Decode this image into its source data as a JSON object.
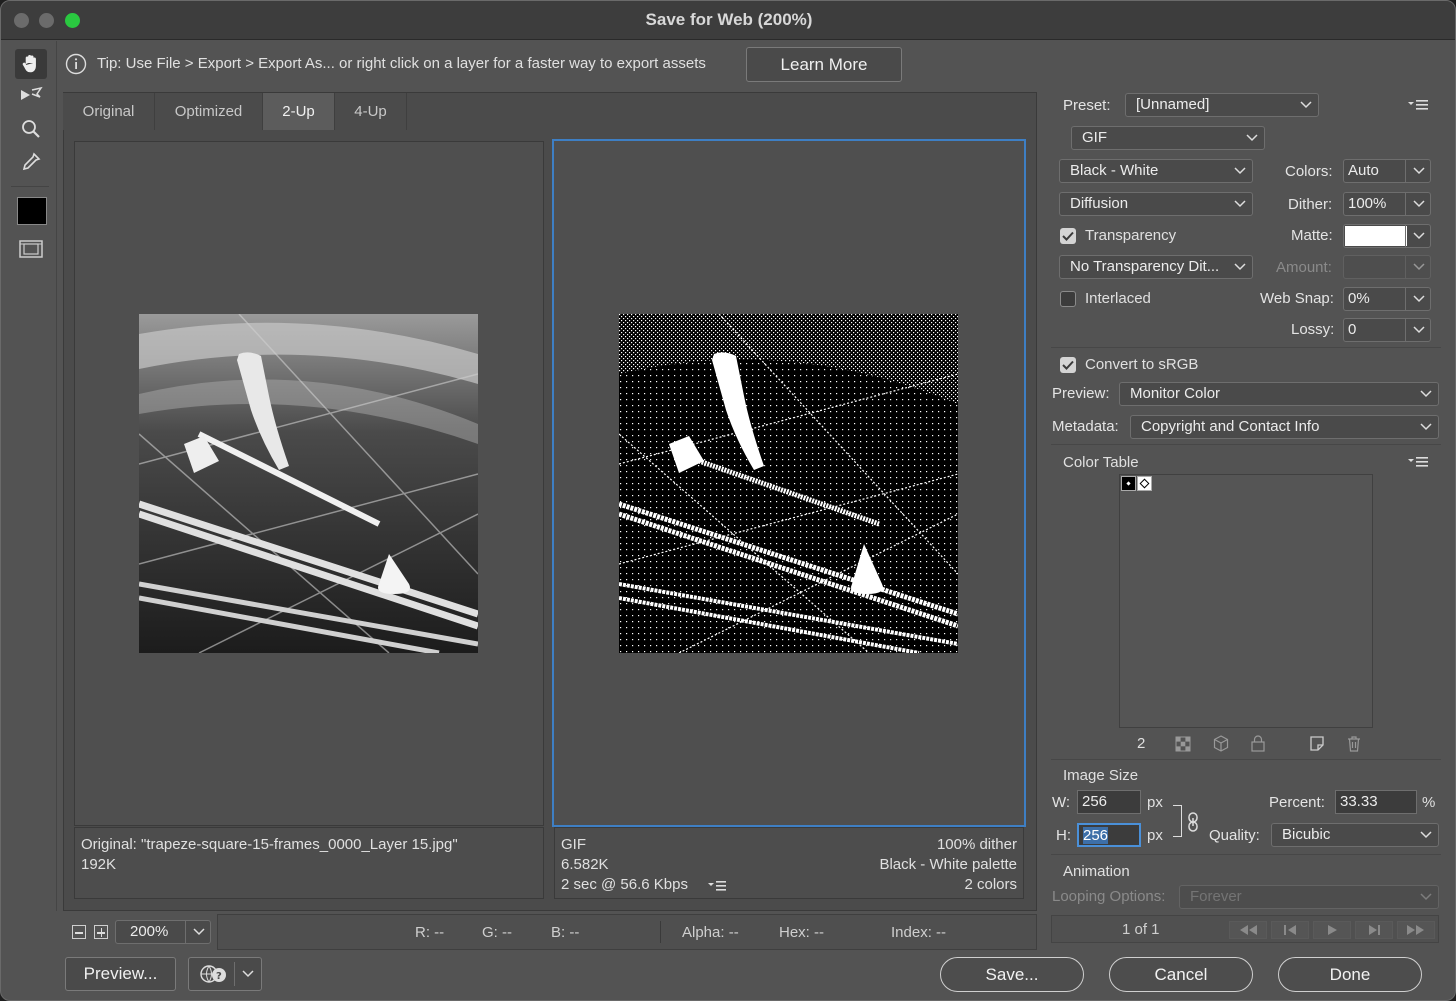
{
  "window": {
    "title": "Save for Web (200%)"
  },
  "tip": {
    "text": "Tip: Use File > Export > Export As...  or right click on a layer for a faster way to export assets",
    "learn_more": "Learn More"
  },
  "tabs": [
    {
      "label": "Original"
    },
    {
      "label": "Optimized"
    },
    {
      "label": "2-Up",
      "active": true
    },
    {
      "label": "4-Up"
    }
  ],
  "left_pane": {
    "name": "Original: \"trapeze-square-15-frames_0000_Layer 15.jpg\"",
    "size": "192K"
  },
  "right_pane": {
    "format": "GIF",
    "size": "6.582K",
    "time": "2 sec @ 56.6 Kbps",
    "dither": "100% dither",
    "palette": "Black - White palette",
    "colors": "2 colors"
  },
  "settings": {
    "preset_label": "Preset:",
    "preset_value": "[Unnamed]",
    "format_value": "GIF",
    "reduction_value": "Black - White",
    "colors_label": "Colors:",
    "colors_value": "Auto",
    "dither_algo": "Diffusion",
    "dither_label": "Dither:",
    "dither_value": "100%",
    "transparency_label": "Transparency",
    "matte_label": "Matte:",
    "matte_color": "#ffffff",
    "trans_dither": "No Transparency Dit...",
    "amount_label": "Amount:",
    "interlaced_label": "Interlaced",
    "websnap_label": "Web Snap:",
    "websnap_value": "0%",
    "lossy_label": "Lossy:",
    "lossy_value": "0",
    "srgb_label": "Convert to sRGB",
    "preview_label": "Preview:",
    "preview_value": "Monitor Color",
    "metadata_label": "Metadata:",
    "metadata_value": "Copyright and Contact Info"
  },
  "color_table": {
    "title": "Color Table",
    "count": "2",
    "swatches": [
      "#000000",
      "#ffffff"
    ]
  },
  "image_size": {
    "title": "Image Size",
    "w_label": "W:",
    "w_value": "256",
    "h_label": "H:",
    "h_value": "256",
    "unit": "px",
    "percent_label": "Percent:",
    "percent_value": "33.33",
    "percent_unit": "%",
    "quality_label": "Quality:",
    "quality_value": "Bicubic"
  },
  "animation": {
    "title": "Animation",
    "looping_label": "Looping Options:",
    "looping_value": "Forever",
    "frame": "1 of 1"
  },
  "statusbar": {
    "zoom": "200%",
    "r": "R: --",
    "g": "G: --",
    "b": "B: --",
    "alpha": "Alpha: --",
    "hex": "Hex: --",
    "index": "Index: --"
  },
  "buttons": {
    "preview": "Preview...",
    "save": "Save...",
    "cancel": "Cancel",
    "done": "Done"
  }
}
